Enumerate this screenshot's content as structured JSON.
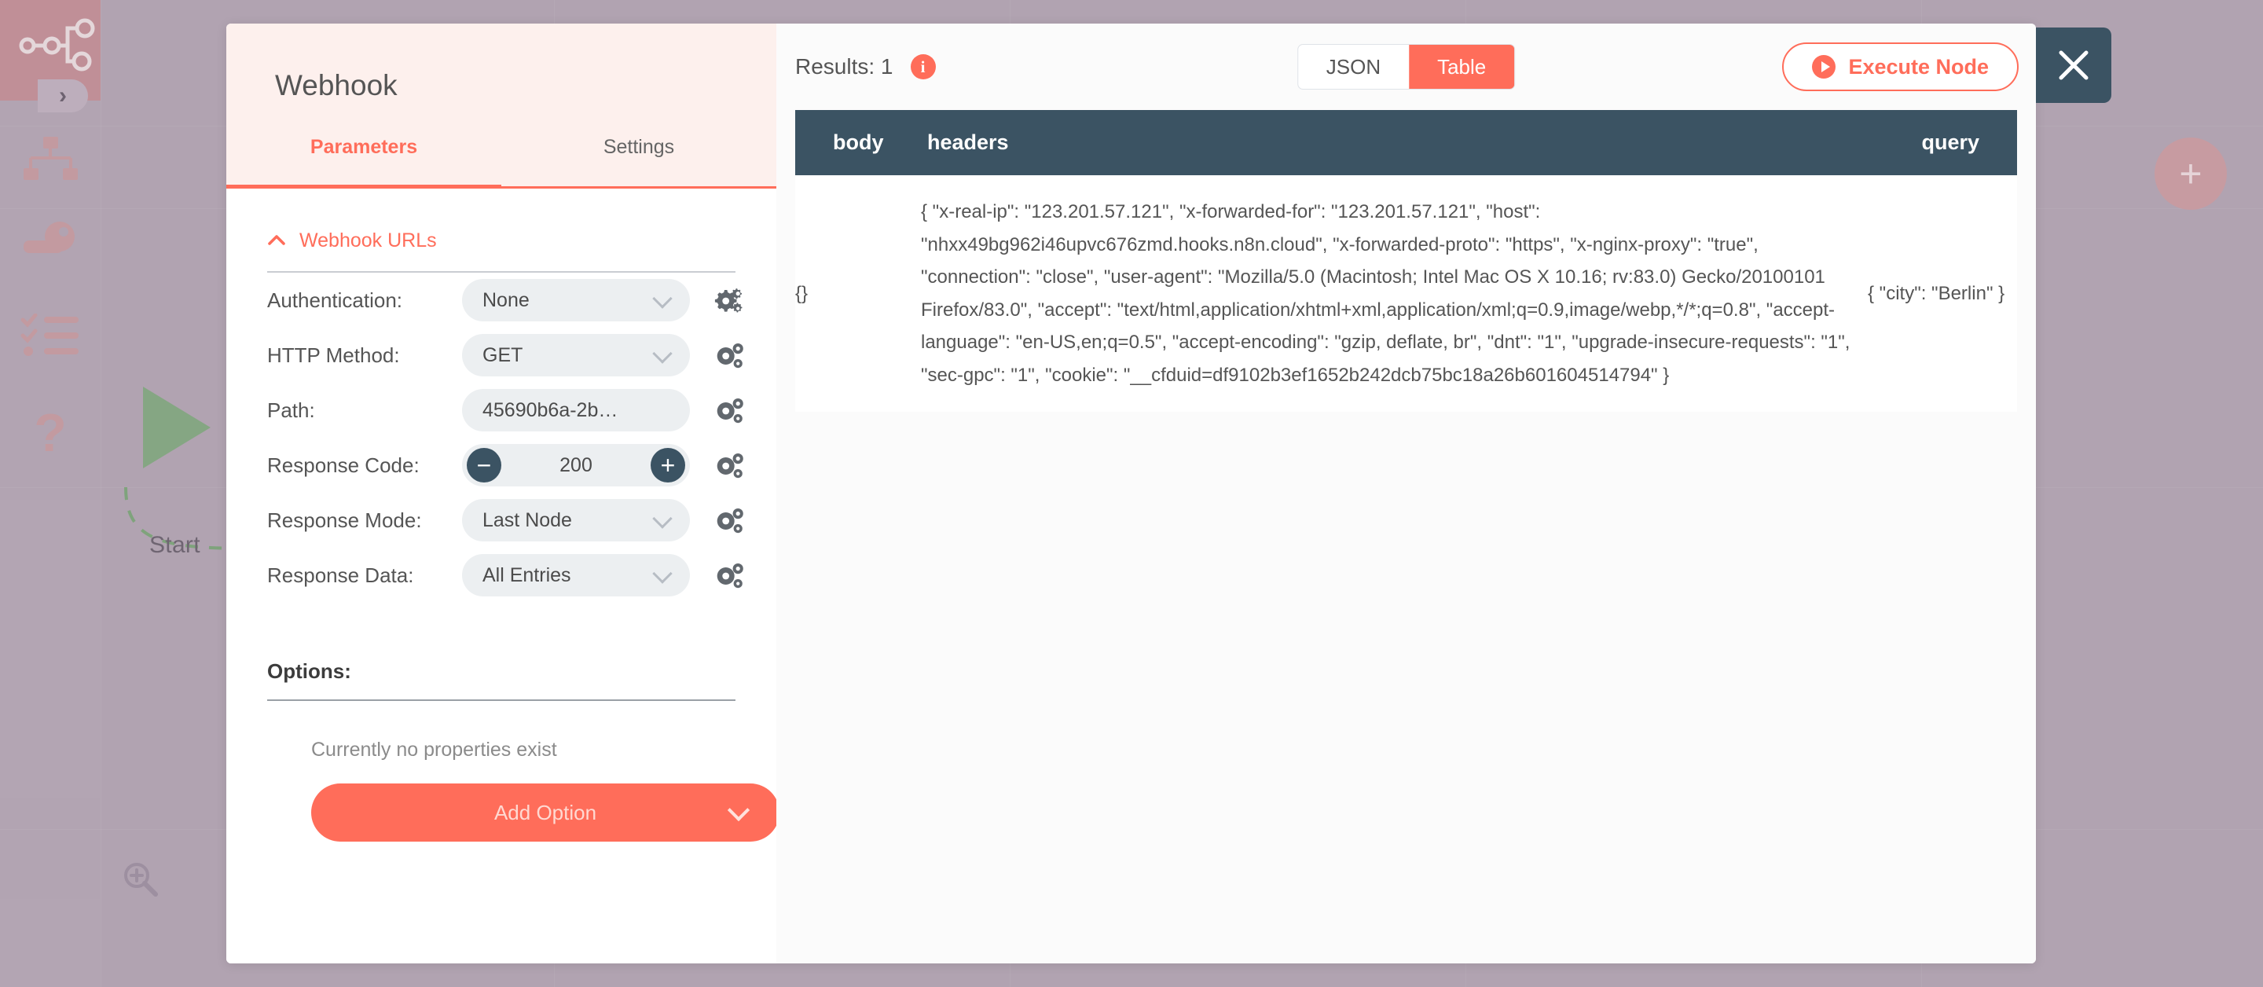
{
  "canvas": {
    "start_node_label": "Start",
    "rail_icons": [
      {
        "name": "n8n-logo-icon"
      },
      {
        "name": "sitemap-icon"
      },
      {
        "name": "key-icon"
      },
      {
        "name": "checklist-icon"
      },
      {
        "name": "help-icon"
      }
    ],
    "collapse_chevron": "›",
    "add_node_label": "+",
    "zoom_in_label": "zoom-in",
    "zoom_out_label": "zoom-out"
  },
  "modal": {
    "node_title": "Webhook",
    "close_label": "×",
    "tabs": [
      {
        "label": "Parameters",
        "active": true
      },
      {
        "label": "Settings",
        "active": false
      }
    ],
    "section": {
      "title": "Webhook URLs",
      "caret": "⌃"
    },
    "parameters": [
      {
        "label": "Authentication:",
        "value": "None",
        "type": "select"
      },
      {
        "label": "HTTP Method:",
        "value": "GET",
        "type": "select"
      },
      {
        "label": "Path:",
        "value": "45690b6a-2b01-  ...",
        "type": "select"
      },
      {
        "label": "Response Code:",
        "value": "200",
        "type": "stepper",
        "minus": "−",
        "plus": "+"
      },
      {
        "label": "Response Mode:",
        "value": "Last Node",
        "type": "select"
      },
      {
        "label": "Response Data:",
        "value": "All Entries",
        "type": "select"
      }
    ],
    "options": {
      "label": "Options:",
      "empty_text": "Currently no properties exist",
      "add_button_label": "Add Option"
    }
  },
  "output": {
    "results_label": "Results: 1",
    "info_badge": "i",
    "view_toggle": [
      {
        "label": "JSON",
        "active": false
      },
      {
        "label": "Table",
        "active": true
      }
    ],
    "execute_button_label": "Execute Node",
    "table": {
      "columns": [
        "body",
        "headers",
        "query"
      ],
      "rows": [
        {
          "body": "{}",
          "headers": "{ \"x-real-ip\": \"123.201.57.121\", \"x-forwarded-for\": \"123.201.57.121\", \"host\": \"nhxx49bg962i46upvc676zmd.hooks.n8n.cloud\", \"x-forwarded-proto\": \"https\", \"x-nginx-proxy\": \"true\", \"connection\": \"close\", \"user-agent\": \"Mozilla/5.0 (Macintosh; Intel Mac OS X 10.16; rv:83.0) Gecko/20100101 Firefox/83.0\", \"accept\": \"text/html,application/xhtml+xml,application/xml;q=0.9,image/webp,*/*;q=0.8\", \"accept-language\": \"en-US,en;q=0.5\", \"accept-encoding\": \"gzip, deflate, br\", \"dnt\": \"1\", \"upgrade-insecure-requests\": \"1\", \"sec-gpc\": \"1\", \"cookie\": \"__cfduid=df9102b3ef1652b242dcb75bc18a26b601604514794\" }",
          "query": "{ \"city\": \"Berlin\" }"
        }
      ]
    }
  },
  "colors": {
    "accent": "#ff6d5a",
    "header_dark": "#3b5363",
    "canvas_bg": "#b1a3b1",
    "start_node_green": "#85a683"
  }
}
